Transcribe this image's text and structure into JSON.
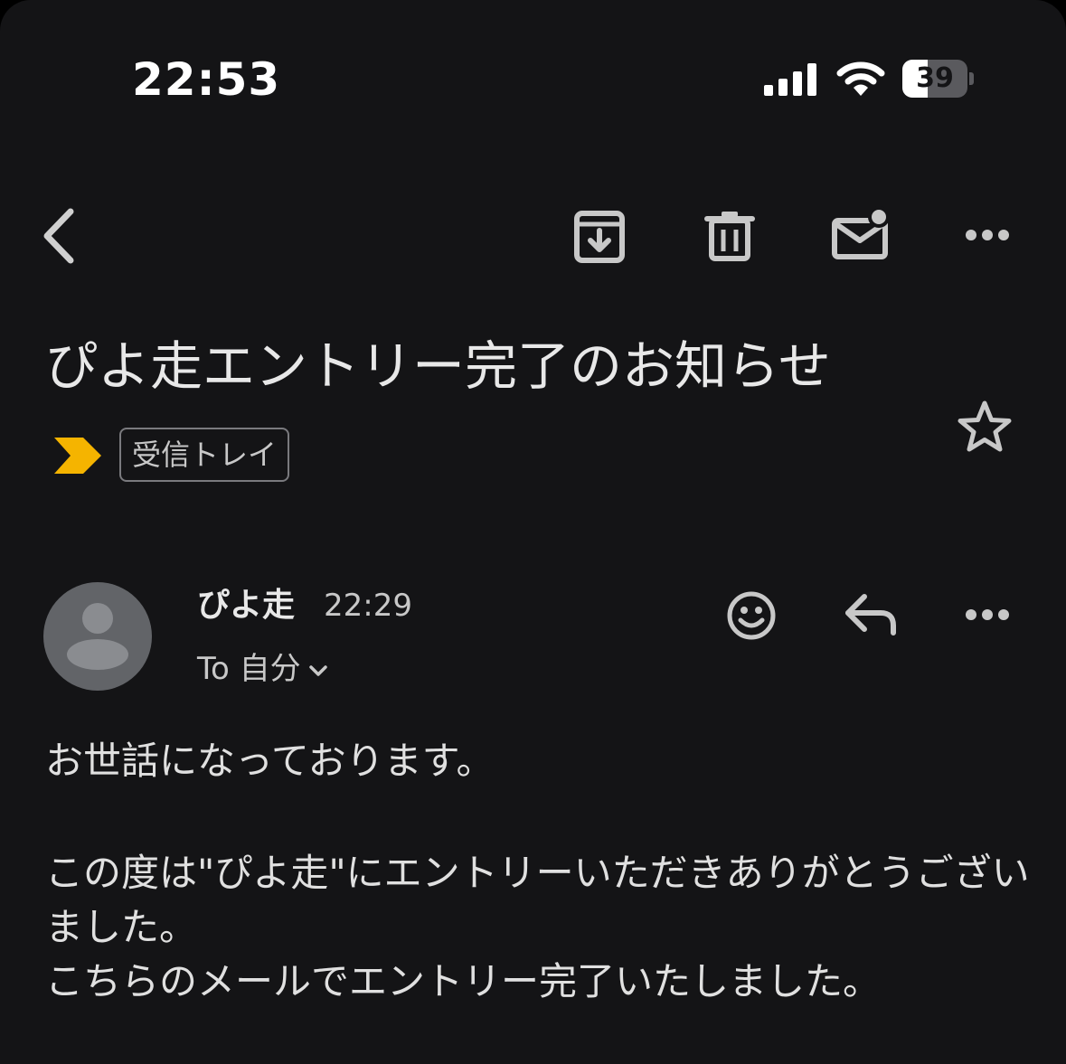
{
  "status_bar": {
    "time": "22:53",
    "battery_level": "39",
    "battery_fraction": 0.39
  },
  "toolbar": {
    "back_icon": "chevron-left-icon",
    "archive_icon": "archive-icon",
    "delete_icon": "trash-icon",
    "mark_unread_icon": "mail-unread-icon",
    "more_icon": "more-horizontal-icon"
  },
  "email": {
    "subject": "ぴよ走エントリー完了のお知らせ",
    "importance_color": "#f5b400",
    "label": "受信トレイ",
    "starred": false
  },
  "message": {
    "sender_name": "ぴよ走",
    "time": "22:29",
    "recipient": "To 自分",
    "body": {
      "greeting": "お世話になっております。",
      "line1": "この度は\"ぴよ走\"にエントリーいただきありがとうございました。",
      "line2": "こちらのメールでエントリー完了いたしました。"
    }
  }
}
